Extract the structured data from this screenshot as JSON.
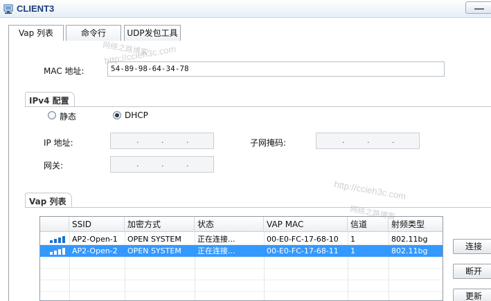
{
  "window": {
    "title": "CLIENT3",
    "icon": "client-app-icon"
  },
  "tabs": [
    {
      "label": "Vap 列表",
      "active": true
    },
    {
      "label": "命令行",
      "active": false
    },
    {
      "label": "UDP发包工具",
      "active": false
    }
  ],
  "mac": {
    "label": "MAC 地址:",
    "value": "54-89-98-64-34-78"
  },
  "ipv4": {
    "group_label": "IPv4 配置",
    "static_label": "静态",
    "dhcp_label": "DHCP",
    "selected": "DHCP",
    "ip_label": "IP 地址:",
    "mask_label": "子网掩码:",
    "gateway_label": "网关:",
    "ip_dots": ".",
    "mask_dots": ".",
    "gateway_dots": "."
  },
  "vap": {
    "group_label": "Vap 列表",
    "columns": [
      "SSID",
      "加密方式",
      "状态",
      "VAP MAC",
      "信道",
      "射频类型"
    ],
    "rows": [
      {
        "ssid": "AP2-Open-1",
        "encryption": "OPEN SYSTEM",
        "status": "正在连接...",
        "mac": "00-E0-FC-17-68-10",
        "channel": "1",
        "radio": "802.11bg",
        "selected": false
      },
      {
        "ssid": "AP2-Open-2",
        "encryption": "OPEN SYSTEM",
        "status": "正在连接...",
        "mac": "00-E0-FC-17-68-11",
        "channel": "1",
        "radio": "802.11bg",
        "selected": true
      }
    ]
  },
  "buttons": {
    "connect": "连接",
    "disconnect": "断开",
    "refresh": "更新"
  },
  "watermarks": {
    "url": "http://ccieh3c.com",
    "site": "网络之路博客"
  },
  "colors": {
    "selection": "#3399ff",
    "title_text": "#1c3d7a",
    "signal": "#1f6fd1"
  }
}
